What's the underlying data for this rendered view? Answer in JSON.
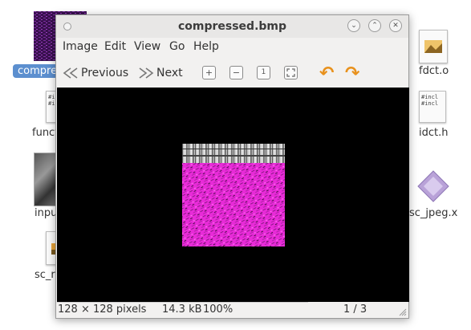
{
  "desktop": {
    "icons": [
      {
        "label": "compre"
      },
      {
        "label": "funct"
      },
      {
        "label": "inpu"
      },
      {
        "label": "sc_r"
      },
      {
        "label": "fdct.o"
      },
      {
        "label": "idct.h"
      },
      {
        "label": "sc_jpeg.x"
      }
    ],
    "textfile_lines": [
      "#in",
      "#i",
      "",
      ","
    ],
    "textfile_lines_right": [
      "#incl",
      "#incl",
      "",
      "e.r.."
    ]
  },
  "window": {
    "title": "compressed.bmp",
    "menu": [
      "Image",
      "Edit",
      "View",
      "Go",
      "Help"
    ],
    "toolbar": {
      "previous_label": "Previous",
      "next_label": "Next"
    },
    "status": {
      "dimensions": "128 × 128 pixels",
      "size": "14.3 kB",
      "zoom": "100%",
      "position": "1 / 3"
    }
  },
  "colors": {
    "selection": "#5c8fcf",
    "image_magenta": "#e82bd8",
    "rotate_icons": "#e8911c"
  }
}
